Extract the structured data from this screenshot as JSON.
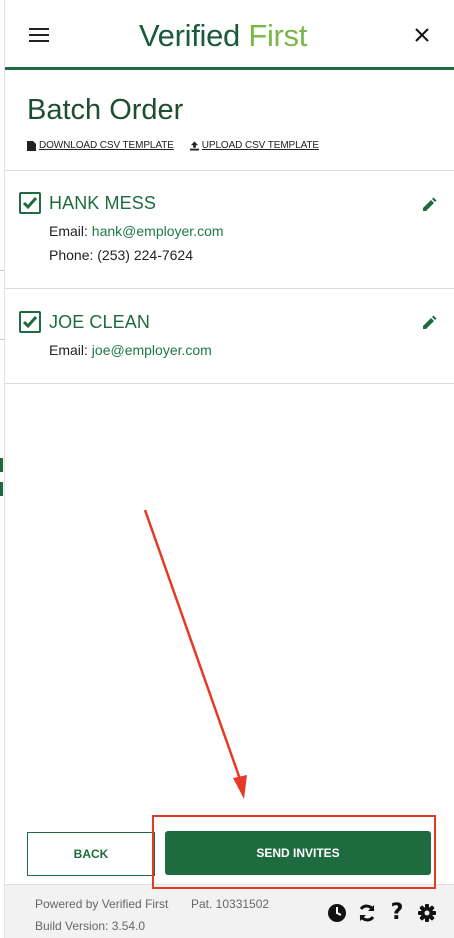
{
  "header": {
    "logo_part1": "Verified",
    "logo_part2": " First"
  },
  "page": {
    "title": "Batch Order",
    "download_link": "DOWNLOAD CSV TEMPLATE",
    "upload_link": "UPLOAD CSV TEMPLATE"
  },
  "contacts": [
    {
      "name": "HANK MESS",
      "email_label": "Email: ",
      "email": "hank@employer.com",
      "phone_label": "Phone: ",
      "phone": "(253) 224-7624",
      "checked": true
    },
    {
      "name": "JOE CLEAN",
      "email_label": "Email: ",
      "email": "joe@employer.com",
      "checked": true
    }
  ],
  "actions": {
    "back_label": "BACK",
    "send_label": "SEND INVITES"
  },
  "footer": {
    "powered_by": "Powered by Verified First",
    "patent": "Pat. 10331502",
    "build": "Build Version: 3.54.0",
    "icons": [
      "clock-icon",
      "refresh-icon",
      "help-icon",
      "settings-icon"
    ]
  },
  "colors": {
    "brand_green": "#1f6b40",
    "logo_light_green": "#7ab648",
    "annotation_red": "#e63a26"
  }
}
